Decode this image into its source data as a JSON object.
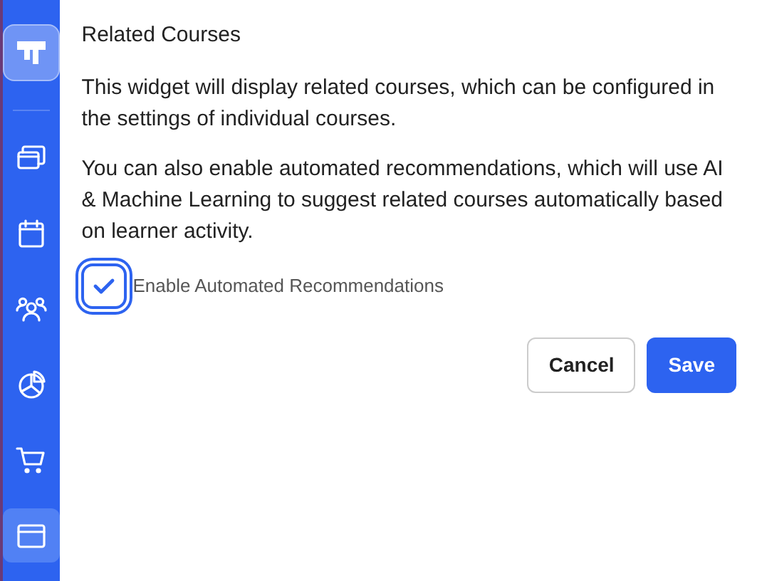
{
  "sidebar": {
    "items": [
      {
        "kind": "stack",
        "selected": false
      },
      {
        "kind": "calendar",
        "selected": false
      },
      {
        "kind": "users",
        "selected": false
      },
      {
        "kind": "pie",
        "selected": false
      },
      {
        "kind": "cart",
        "selected": false
      },
      {
        "kind": "window",
        "selected": true
      }
    ]
  },
  "panel": {
    "title": "Related Courses",
    "paragraphs": [
      "This widget will display related courses, which can be configured in the settings of individual courses.",
      "You can also enable automated recommendations, which will use AI & Machine Learning to suggest related courses automatically based on learner activity."
    ],
    "checkbox": {
      "label": "Enable Automated Recommendations",
      "checked": true
    },
    "buttons": [
      {
        "label": "Cancel",
        "kind": "secondary"
      },
      {
        "label": "Save",
        "kind": "primary"
      }
    ]
  }
}
